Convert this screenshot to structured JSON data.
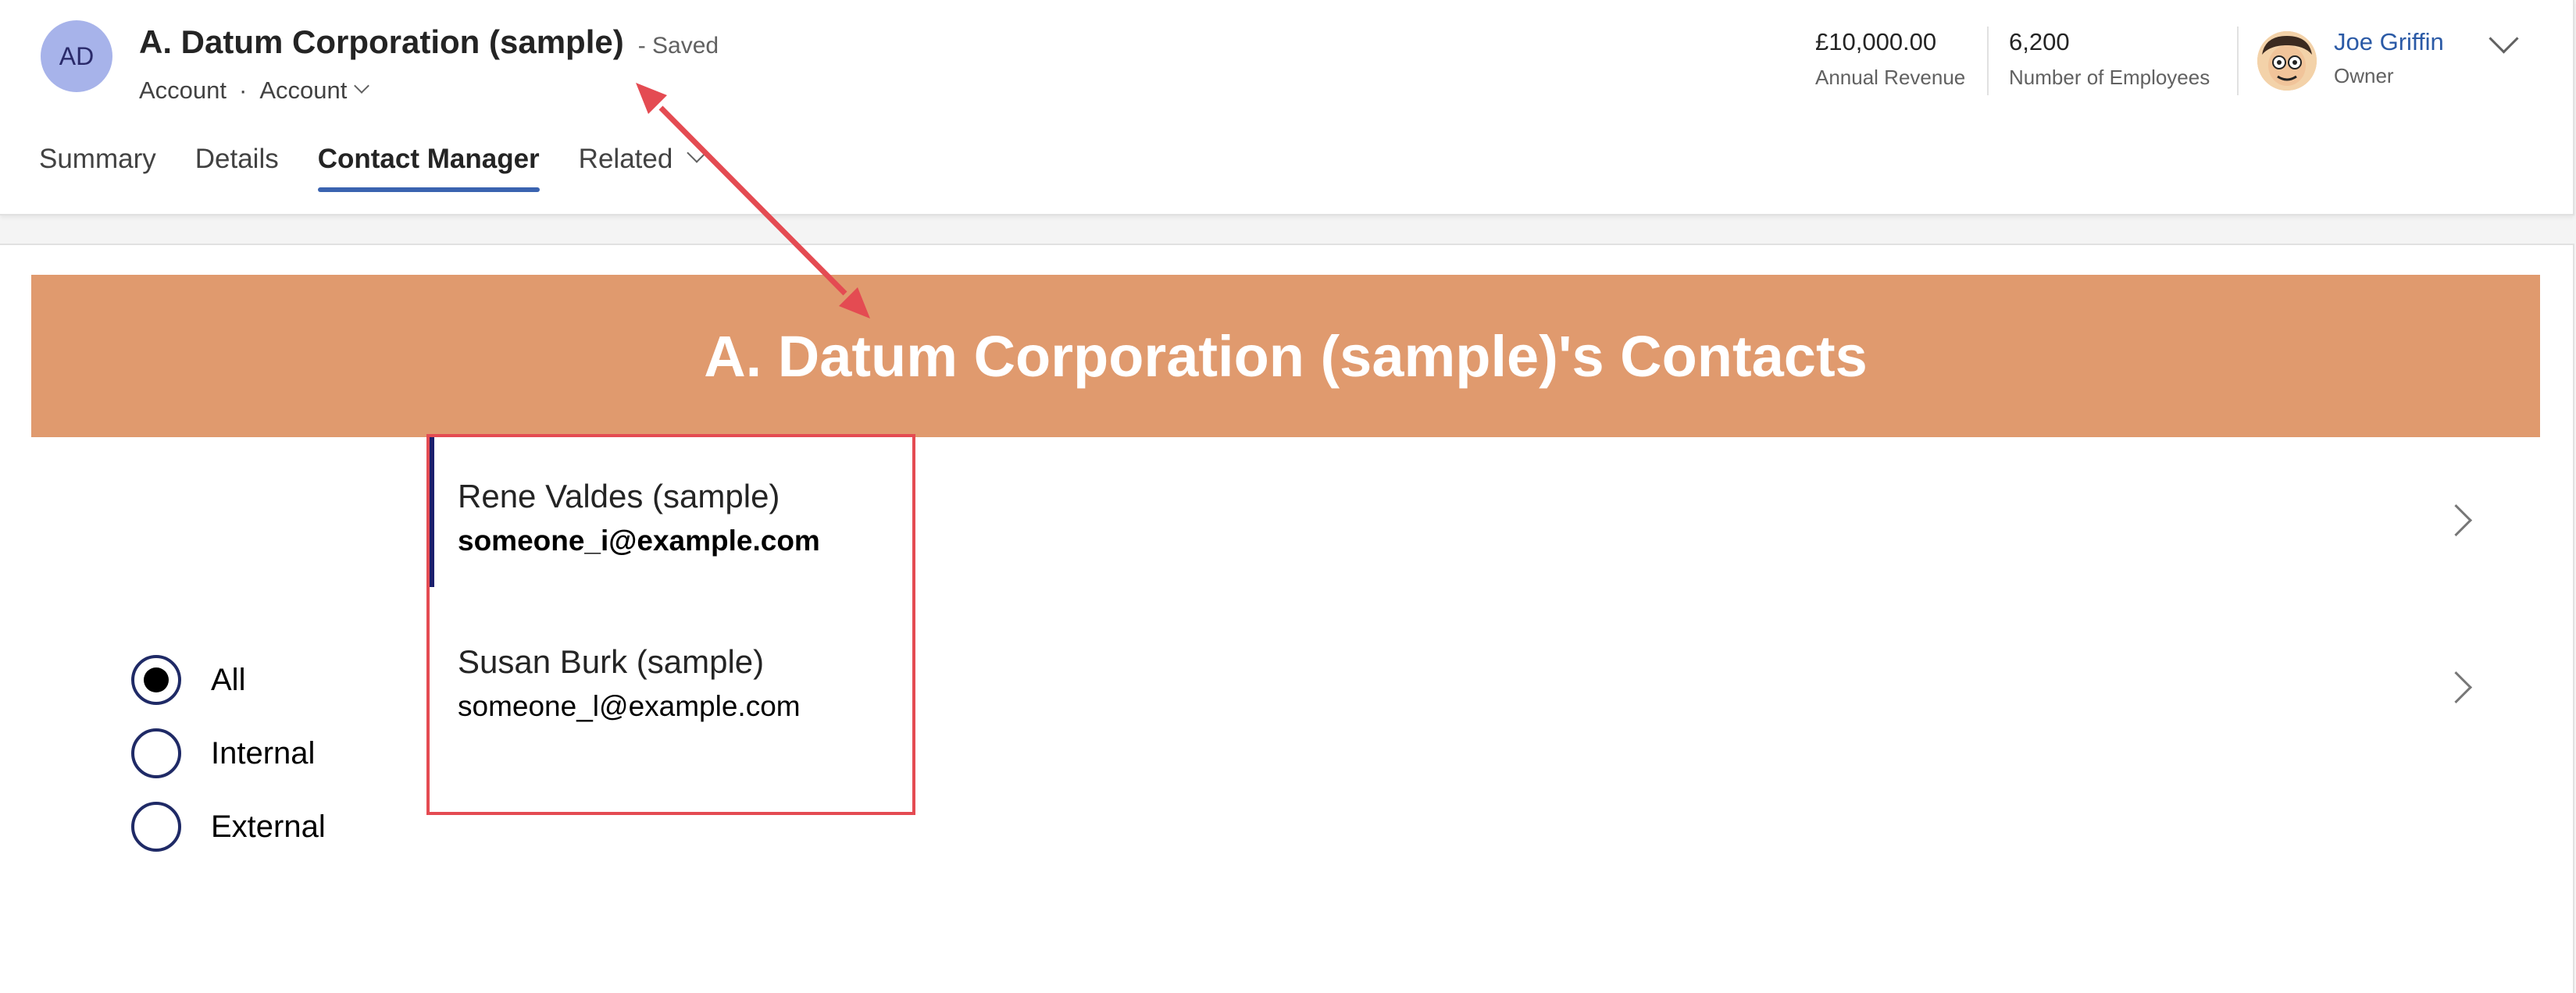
{
  "header": {
    "avatar_initials": "AD",
    "record_title": "A. Datum Corporation (sample)",
    "save_status": "- Saved",
    "entity_type": "Account",
    "separator": "·",
    "form_selector": "Account",
    "tabs": [
      {
        "label": "Summary"
      },
      {
        "label": "Details"
      },
      {
        "label": "Contact Manager"
      },
      {
        "label": "Related"
      }
    ],
    "kpis": [
      {
        "value": "£10,000.00",
        "label": "Annual Revenue"
      },
      {
        "value": "6,200",
        "label": "Number of Employees"
      }
    ],
    "owner": {
      "name": "Joe Griffin",
      "role": "Owner"
    }
  },
  "app": {
    "banner_title": "A. Datum Corporation (sample)'s Contacts",
    "filter_options": [
      {
        "label": "All",
        "selected": true
      },
      {
        "label": "Internal",
        "selected": false
      },
      {
        "label": "External",
        "selected": false
      }
    ],
    "contacts": [
      {
        "name": "Rene Valdes (sample)",
        "email": "someone_i@example.com",
        "selected": true
      },
      {
        "name": "Susan Burk (sample)",
        "email": "someone_l@example.com",
        "selected": false
      }
    ]
  },
  "colors": {
    "banner": "#e09a6e",
    "tab_underline": "#3a63b0",
    "selection_indicator": "#1c1f6d",
    "annotation": "#e44b52",
    "owner_link": "#2b5aa6"
  },
  "icons": [
    "chevron-down-icon",
    "chevron-right-icon",
    "owner-photo",
    "annotation-arrow"
  ]
}
